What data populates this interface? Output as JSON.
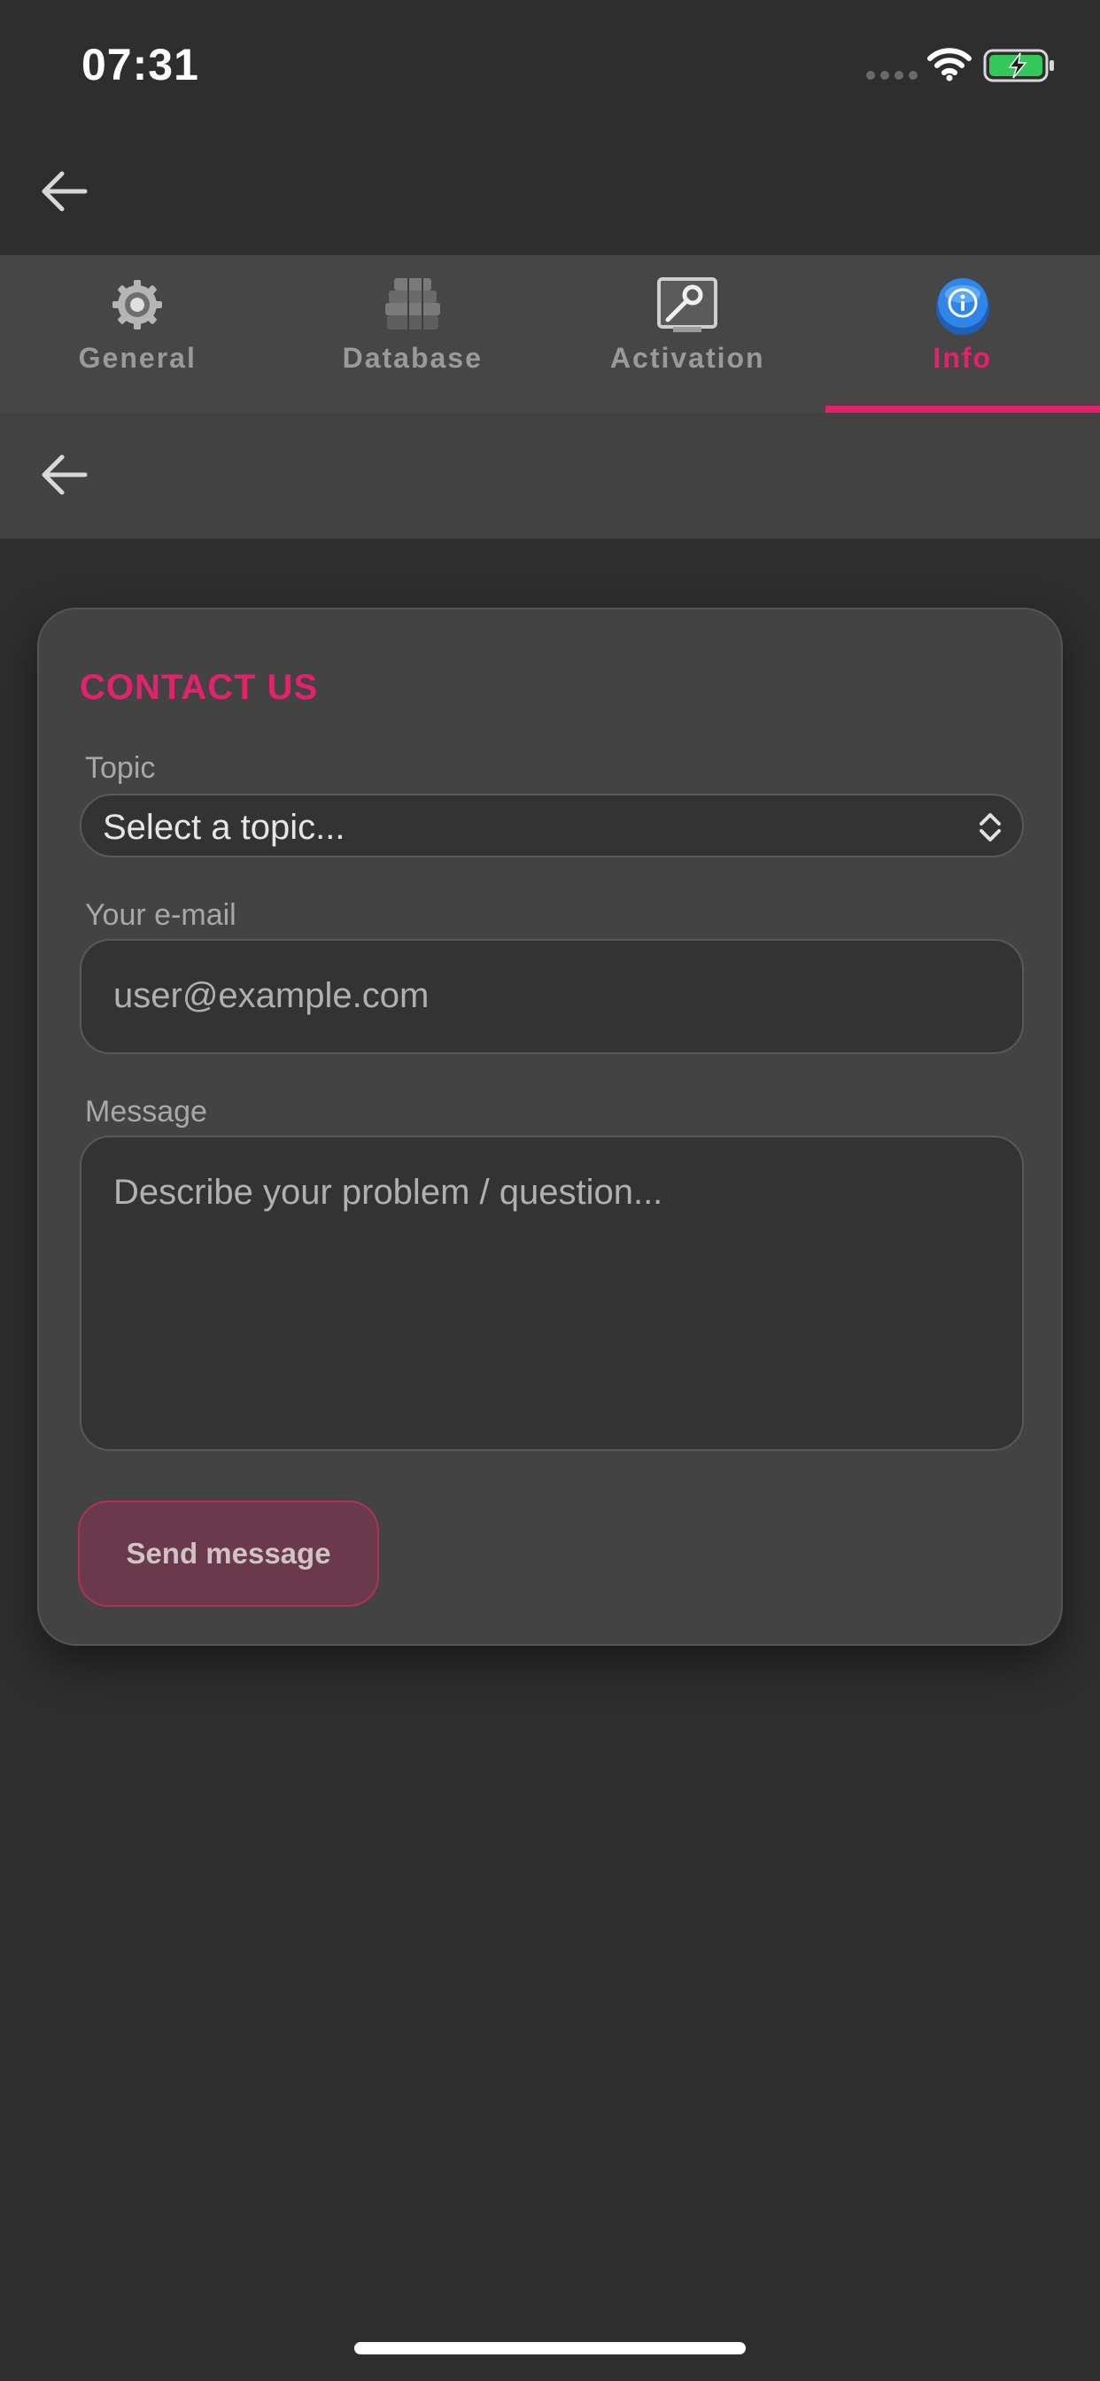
{
  "status_bar": {
    "time": "07:31"
  },
  "tabs": [
    {
      "label": "General",
      "icon": "gear-icon",
      "active": false
    },
    {
      "label": "Database",
      "icon": "database-icon",
      "active": false
    },
    {
      "label": "Activation",
      "icon": "key-monitor-icon",
      "active": false
    },
    {
      "label": "Info",
      "icon": "info-icon",
      "active": true
    }
  ],
  "contact_form": {
    "title": "CONTACT US",
    "topic_label": "Topic",
    "topic_value": "Select a topic...",
    "email_label": "Your e-mail",
    "email_placeholder": "user@example.com",
    "message_label": "Message",
    "message_placeholder": "Describe your problem / question...",
    "send_label": "Send message"
  },
  "colors": {
    "accent": "#e3216f",
    "background": "#2e2e2e",
    "card": "#434343"
  }
}
